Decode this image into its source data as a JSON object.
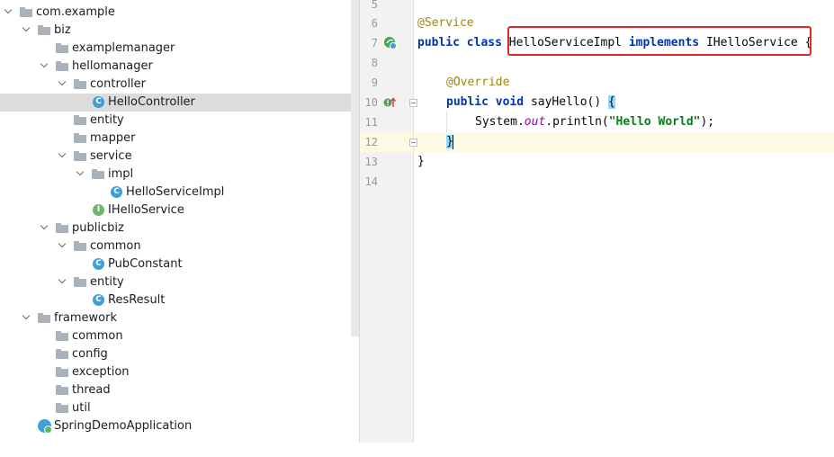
{
  "project_tree": {
    "items": [
      {
        "label": "com.example",
        "type": "package",
        "depth": 1,
        "expanded": true
      },
      {
        "label": "biz",
        "type": "package",
        "depth": 2,
        "expanded": true
      },
      {
        "label": "examplemanager",
        "type": "package",
        "depth": 3,
        "expanded": false
      },
      {
        "label": "hellomanager",
        "type": "package",
        "depth": 3,
        "expanded": true
      },
      {
        "label": "controller",
        "type": "package",
        "depth": 4,
        "expanded": true
      },
      {
        "label": "HelloController",
        "type": "class",
        "depth": 5,
        "selected": true
      },
      {
        "label": "entity",
        "type": "package",
        "depth": 4,
        "expanded": false
      },
      {
        "label": "mapper",
        "type": "package",
        "depth": 4,
        "expanded": false
      },
      {
        "label": "service",
        "type": "package",
        "depth": 4,
        "expanded": true
      },
      {
        "label": "impl",
        "type": "package",
        "depth": 5,
        "expanded": true
      },
      {
        "label": "HelloServiceImpl",
        "type": "class",
        "depth": 6
      },
      {
        "label": "IHelloService",
        "type": "interface",
        "depth": 5
      },
      {
        "label": "publicbiz",
        "type": "package",
        "depth": 3,
        "expanded": true
      },
      {
        "label": "common",
        "type": "package",
        "depth": 4,
        "expanded": true
      },
      {
        "label": "PubConstant",
        "type": "class",
        "depth": 5
      },
      {
        "label": "entity",
        "type": "package",
        "depth": 4,
        "expanded": true
      },
      {
        "label": "ResResult",
        "type": "class",
        "depth": 5
      },
      {
        "label": "framework",
        "type": "package",
        "depth": 2,
        "expanded": true
      },
      {
        "label": "common",
        "type": "package",
        "depth": 3,
        "expanded": false
      },
      {
        "label": "config",
        "type": "package",
        "depth": 3,
        "expanded": false
      },
      {
        "label": "exception",
        "type": "package",
        "depth": 3,
        "expanded": false
      },
      {
        "label": "thread",
        "type": "package",
        "depth": 3,
        "expanded": false
      },
      {
        "label": "util",
        "type": "package",
        "depth": 3,
        "expanded": false
      },
      {
        "label": "SpringDemoApplication",
        "type": "spring-app",
        "depth": 2
      }
    ]
  },
  "editor": {
    "line_numbers": [
      "5",
      "6",
      "7",
      "8",
      "9",
      "10",
      "11",
      "12",
      "13",
      "14"
    ],
    "current_line": "12",
    "code": {
      "l6_annotation": "@Service",
      "l7_public": "public",
      "l7_class": "class",
      "l7_name": "HelloServiceImpl",
      "l7_implements": "implements",
      "l7_iface": "IHelloService",
      "l7_brace": "{",
      "l9_annotation": "@Override",
      "l10_public": "public",
      "l10_void": "void",
      "l10_method": "sayHello()",
      "l10_brace": "{",
      "l11_system": "System.",
      "l11_out": "out",
      "l11_println": ".println(",
      "l11_string": "\"Hello World\"",
      "l11_end": ");",
      "l12_brace": "}",
      "l13_brace": "}"
    },
    "highlight_color": "#e0262b"
  }
}
